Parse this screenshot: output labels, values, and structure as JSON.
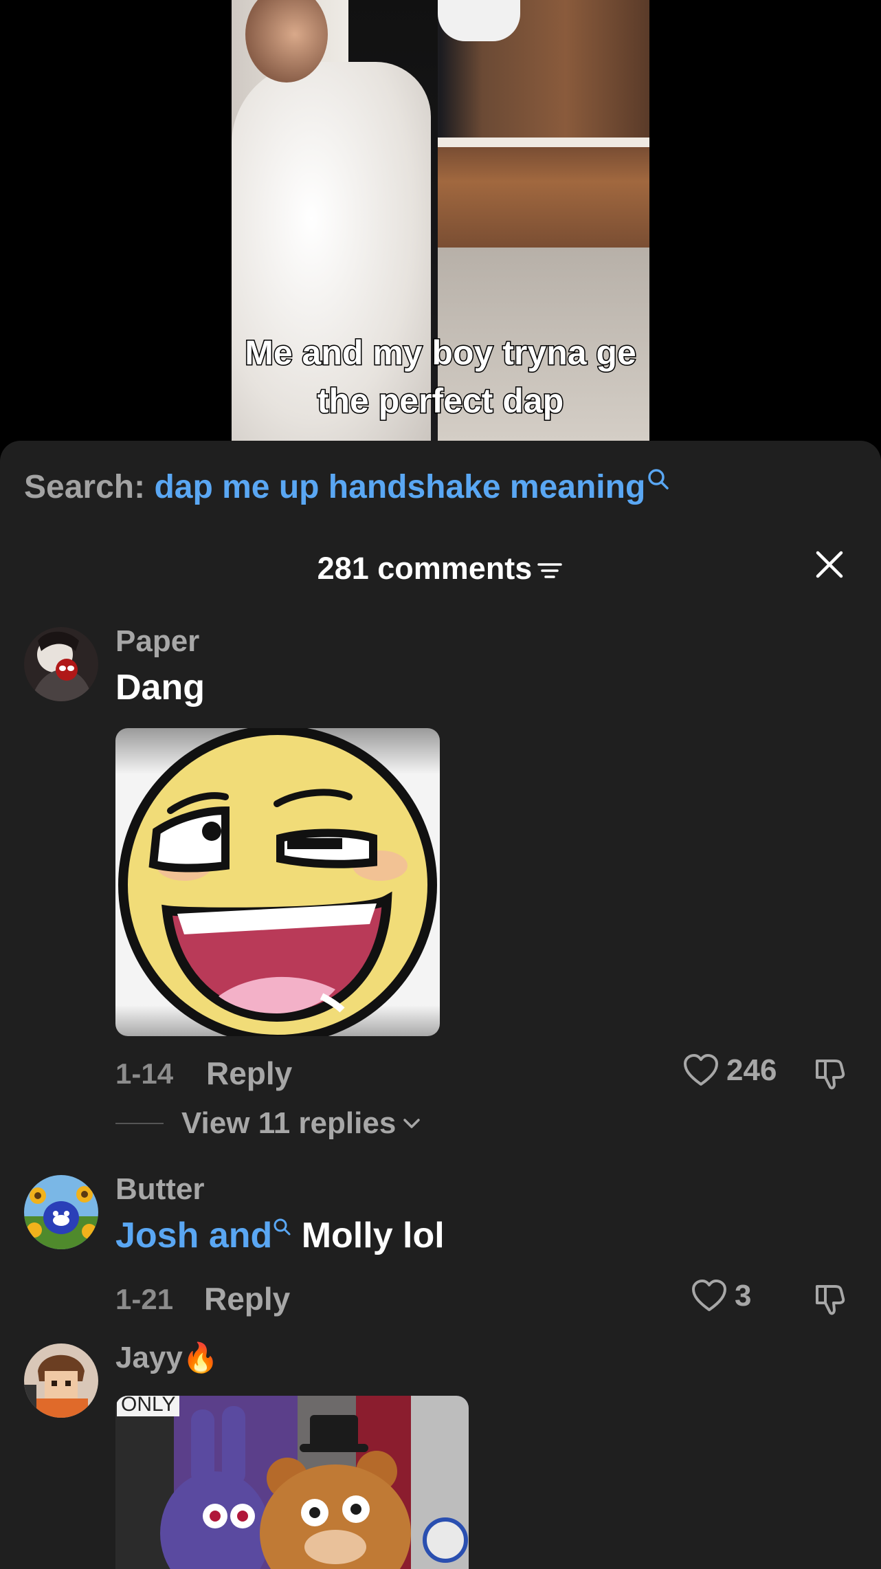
{
  "video": {
    "caption_line1": "Me and my boy tryna ge",
    "caption_line2": "the perfect dap"
  },
  "search": {
    "label": "Search:",
    "query": "dap me up handshake meaning",
    "icon": "search-icon"
  },
  "comments_header": {
    "count_label": "281 comments",
    "filter_icon": "filter-icon",
    "close_icon": "close-icon"
  },
  "comments": [
    {
      "username": "Paper",
      "text": "Dang",
      "attachment": "awesome-face-sticker",
      "date": "1-14",
      "reply_label": "Reply",
      "likes": "246",
      "view_replies": "View 11 replies"
    },
    {
      "username": "Butter",
      "text_link": "Josh and",
      "text_rest": " Molly lol",
      "date": "1-21",
      "reply_label": "Reply",
      "likes": "3"
    },
    {
      "username": "Jayy",
      "username_emoji": "🔥",
      "attachment": "fnaf-characters-image",
      "attachment_text": "ONLY"
    }
  ],
  "colors": {
    "panel_bg": "#1f1f1f",
    "link_blue": "#5aa7f3",
    "muted_text": "#a7a7a7"
  }
}
